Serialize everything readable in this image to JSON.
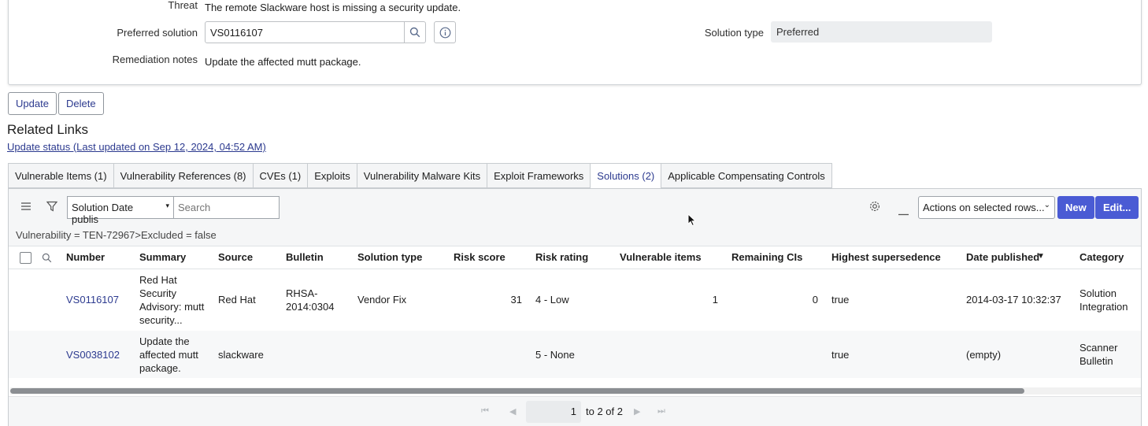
{
  "form": {
    "threat_label": "Threat",
    "threat_value": "The remote Slackware host is missing a security update.",
    "preferred_solution_label": "Preferred solution",
    "preferred_solution_value": "VS0116107",
    "solution_type_label": "Solution type",
    "solution_type_value": "Preferred",
    "remediation_notes_label": "Remediation notes",
    "remediation_notes_value": "Update the affected mutt package."
  },
  "buttons": {
    "update": "Update",
    "delete": "Delete"
  },
  "related": {
    "heading": "Related Links",
    "update_status_link": "Update status (Last updated on Sep 12, 2024, 04:52 AM)"
  },
  "tabs": [
    {
      "label": "Vulnerable Items (1)",
      "active": false
    },
    {
      "label": "Vulnerability References (8)",
      "active": false
    },
    {
      "label": "CVEs (1)",
      "active": false
    },
    {
      "label": "Exploits",
      "active": false
    },
    {
      "label": "Vulnerability Malware Kits",
      "active": false
    },
    {
      "label": "Exploit Frameworks",
      "active": false
    },
    {
      "label": "Solutions (2)",
      "active": true
    },
    {
      "label": "Applicable Compensating Controls",
      "active": false
    }
  ],
  "list": {
    "search_field_select": "Solution Date publis",
    "search_placeholder": "Search",
    "actions_select": "Actions on selected rows...",
    "new_button": "New",
    "edit_button": "Edit...",
    "filter_breadcrumb": "Vulnerability = TEN-72967>Excluded = false",
    "columns": [
      "Number",
      "Summary",
      "Source",
      "Bulletin",
      "Solution type",
      "Risk score",
      "Risk rating",
      "Vulnerable items",
      "Remaining CIs",
      "Highest supersedence",
      "Date published",
      "Category"
    ],
    "rows": [
      {
        "number": "VS0116107",
        "summary": [
          "Red Hat",
          "Security",
          "Advisory: mutt",
          "security..."
        ],
        "source": "Red Hat",
        "bulletin": [
          "RHSA-",
          "2014:0304"
        ],
        "solution_type": "Vendor Fix",
        "risk_score": "31",
        "risk_rating": "4 - Low",
        "vulnerable_items": "1",
        "remaining_cis": "0",
        "highest_supersedence": "true",
        "date_published": "2014-03-17 10:32:37",
        "category": [
          "Solution",
          "Integration"
        ]
      },
      {
        "number": "VS0038102",
        "summary": [
          "Update the",
          "affected mutt",
          "package."
        ],
        "source": "slackware",
        "bulletin": [
          "",
          ""
        ],
        "solution_type": "",
        "risk_score": "",
        "risk_rating": "5 - None",
        "vulnerable_items": "",
        "remaining_cis": "",
        "highest_supersedence": "true",
        "date_published": "(empty)",
        "category": [
          "Scanner",
          "Bulletin"
        ]
      }
    ],
    "pager": {
      "current_page": "1",
      "range_text": "to 2 of 2"
    }
  },
  "colors": {
    "accent": "#4a5bd4",
    "link": "#2c3a8f"
  }
}
